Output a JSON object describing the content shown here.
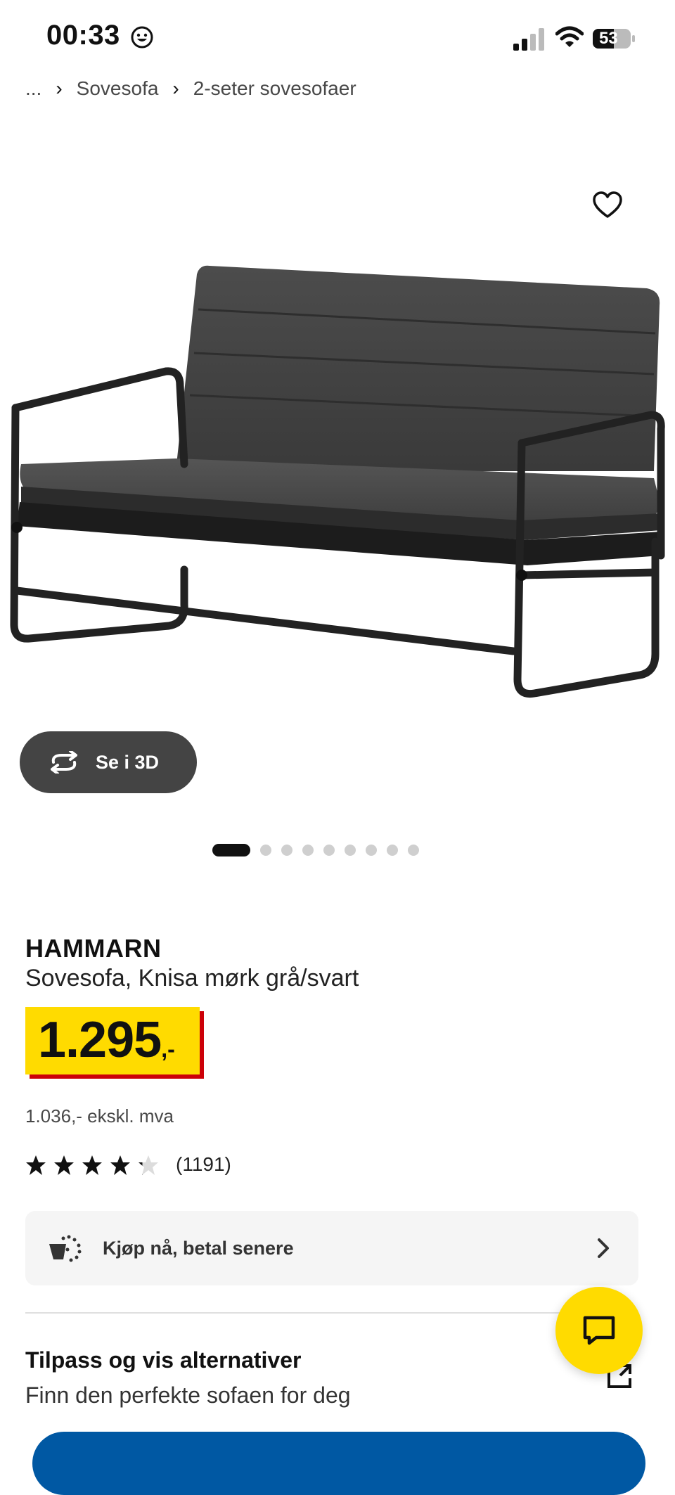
{
  "status_bar": {
    "time": "00:33",
    "battery": "53"
  },
  "breadcrumb": {
    "ellipsis": "...",
    "items": [
      "Sovesofa",
      "2-seter sovesofaer"
    ]
  },
  "gallery": {
    "view_3d_label": "Se i 3D",
    "dot_count": 9,
    "active_index": 0
  },
  "product": {
    "name": "HAMMARN",
    "description": "Sovesofa, Knisa mørk grå/svart",
    "price": "1.295",
    "price_suffix": ",-",
    "price_ex_vat": "1.036,- ekskl. mva",
    "rating": 4.2,
    "rating_max": 5,
    "review_count": "(1191)"
  },
  "pay_later": {
    "label": "Kjøp nå, betal senere"
  },
  "customize": {
    "title": "Tilpass og vis alternativer",
    "subtitle": "Finn den perfekte sofaen for deg"
  },
  "colors": {
    "ikea_yellow": "#ffdb00",
    "ikea_blue": "#0058a3",
    "price_red": "#cc0008"
  }
}
